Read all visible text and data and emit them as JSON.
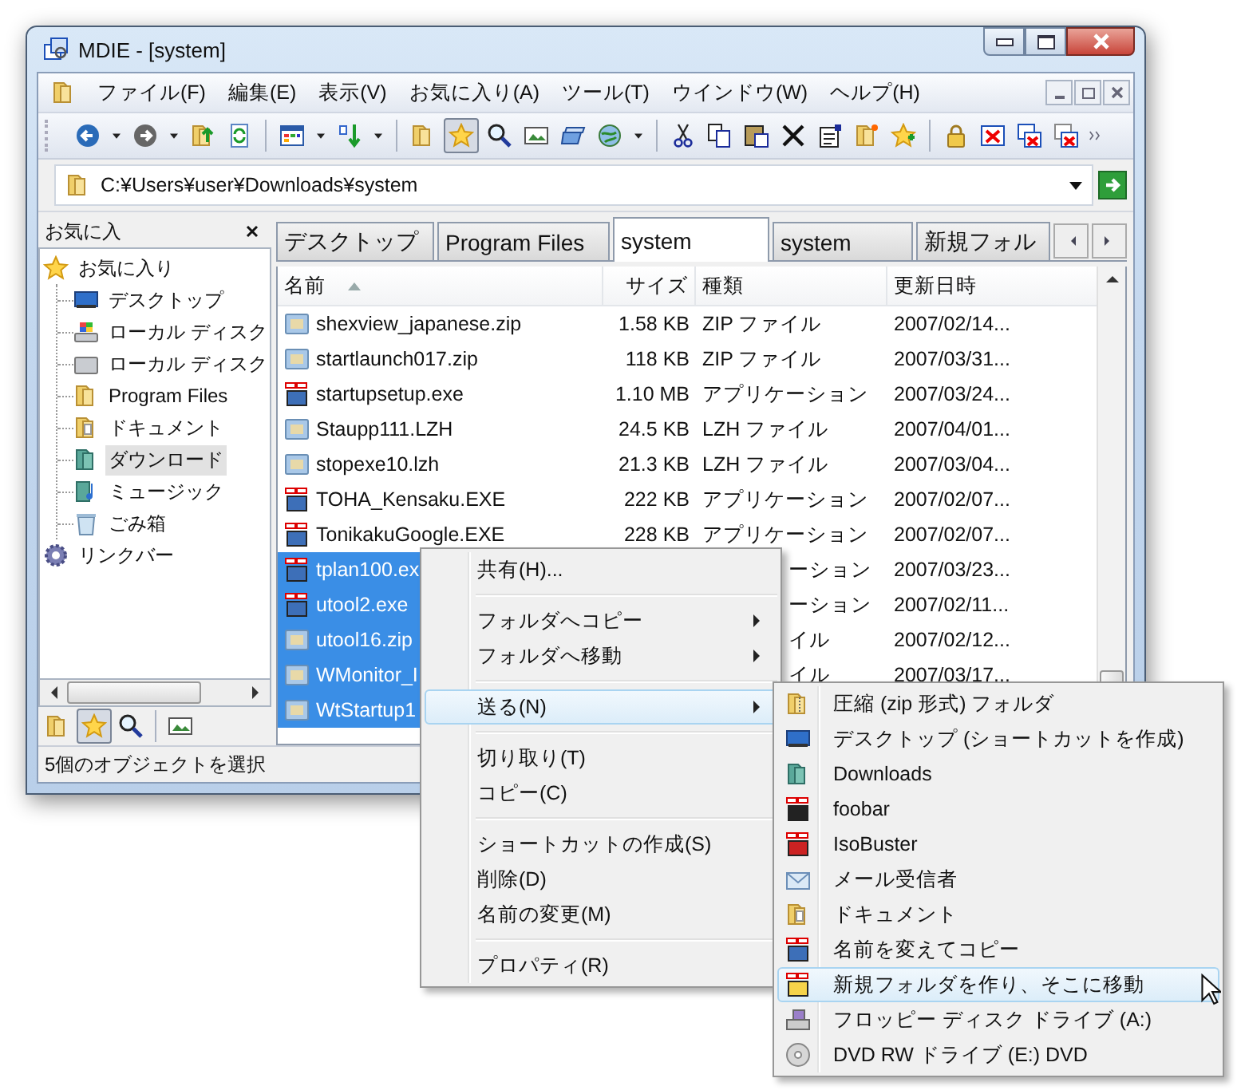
{
  "window": {
    "title": "MDIE - [system]"
  },
  "menubar": [
    "ファイル(F)",
    "編集(E)",
    "表示(V)",
    "お気に入り(A)",
    "ツール(T)",
    "ウインドウ(W)",
    "ヘルプ(H)"
  ],
  "toolbar": {
    "favorites_pressed": true
  },
  "address": {
    "value": "C:¥Users¥user¥Downloads¥system"
  },
  "sidebar": {
    "title": "お気に入",
    "favorites_pressed": true,
    "tree": [
      {
        "kind": "star",
        "label": "お気に入り",
        "selected": false,
        "children": [
          {
            "kind": "monitor",
            "label": "デスクトップ",
            "selected": false
          },
          {
            "kind": "windrive",
            "label": "ローカル ディスク",
            "selected": false
          },
          {
            "kind": "drive",
            "label": "ローカル ディスク",
            "selected": false
          },
          {
            "kind": "folder",
            "label": "Program Files",
            "selected": false
          },
          {
            "kind": "docs",
            "label": "ドキュメント",
            "selected": false
          },
          {
            "kind": "dl",
            "label": "ダウンロード",
            "selected": true
          },
          {
            "kind": "music",
            "label": "ミュージック",
            "selected": false
          },
          {
            "kind": "trash",
            "label": "ごみ箱",
            "selected": false
          }
        ]
      },
      {
        "kind": "gear",
        "label": "リンクバー",
        "selected": false
      }
    ]
  },
  "tabs": [
    {
      "label": "デスクトップ",
      "selected": false
    },
    {
      "label": "Program Files",
      "selected": false
    },
    {
      "label": "system",
      "selected": true
    },
    {
      "label": "system",
      "selected": false
    },
    {
      "label": "新規フォル",
      "selected": false
    }
  ],
  "columns": [
    {
      "label": "名前",
      "sorted": true
    },
    {
      "label": "サイズ",
      "sorted": false
    },
    {
      "label": "種類",
      "sorted": false
    },
    {
      "label": "更新日時",
      "sorted": false
    }
  ],
  "rows": [
    {
      "kind": "archive",
      "name": "shexview_japanese.zip",
      "size": "1.58 KB",
      "type": "ZIP ファイル",
      "modified": "2007/02/14...",
      "selected": false
    },
    {
      "kind": "archive",
      "name": "startlaunch017.zip",
      "size": "118 KB",
      "type": "ZIP ファイル",
      "modified": "2007/03/31...",
      "selected": false
    },
    {
      "kind": "exe",
      "name": "startupsetup.exe",
      "size": "1.10 MB",
      "type": "アプリケーション",
      "modified": "2007/03/24...",
      "selected": false
    },
    {
      "kind": "archive",
      "name": "Staupp111.LZH",
      "size": "24.5 KB",
      "type": "LZH ファイル",
      "modified": "2007/04/01...",
      "selected": false
    },
    {
      "kind": "archive",
      "name": "stopexe10.lzh",
      "size": "21.3 KB",
      "type": "LZH ファイル",
      "modified": "2007/03/04...",
      "selected": false
    },
    {
      "kind": "exe",
      "name": "TOHA_Kensaku.EXE",
      "size": "222 KB",
      "type": "アプリケーション",
      "modified": "2007/02/07...",
      "selected": false
    },
    {
      "kind": "exe",
      "name": "TonikakuGoogle.EXE",
      "size": "228 KB",
      "type": "アプリケーション",
      "modified": "2007/02/07...",
      "selected": false
    },
    {
      "kind": "exe",
      "name": "tplan100.ex",
      "type": "ーション",
      "modified": "2007/03/23...",
      "selected": true
    },
    {
      "kind": "exe",
      "name": "utool2.exe",
      "type": "ーション",
      "modified": "2007/02/11...",
      "selected": true
    },
    {
      "kind": "archive",
      "name": "utool16.zip",
      "type": "イル",
      "modified": "2007/02/12...",
      "selected": true
    },
    {
      "kind": "archive",
      "name": "WMonitor_I",
      "type": "イル",
      "modified": "2007/03/17...",
      "selected": true
    },
    {
      "kind": "archive",
      "name": "WtStartup1",
      "selected": true
    }
  ],
  "status_bar": "5個のオブジェクトを選択",
  "context_menu": [
    {
      "kind": "item",
      "label": "共有(H)...",
      "submenu": false,
      "selected": false
    },
    {
      "kind": "separator"
    },
    {
      "kind": "item",
      "label": "フォルダへコピー",
      "submenu": true,
      "selected": false
    },
    {
      "kind": "item",
      "label": "フォルダへ移動",
      "submenu": true,
      "selected": false
    },
    {
      "kind": "separator"
    },
    {
      "kind": "item",
      "label": "送る(N)",
      "submenu": true,
      "selected": true
    },
    {
      "kind": "separator"
    },
    {
      "kind": "item",
      "label": "切り取り(T)",
      "submenu": false,
      "selected": false
    },
    {
      "kind": "item",
      "label": "コピー(C)",
      "submenu": false,
      "selected": false
    },
    {
      "kind": "separator"
    },
    {
      "kind": "item",
      "label": "ショートカットの作成(S)",
      "submenu": false,
      "selected": false
    },
    {
      "kind": "item",
      "label": "削除(D)",
      "submenu": false,
      "selected": false
    },
    {
      "kind": "item",
      "label": "名前の変更(M)",
      "submenu": false,
      "selected": false
    },
    {
      "kind": "separator"
    },
    {
      "kind": "item",
      "label": "プロパティ(R)",
      "submenu": false,
      "selected": false
    }
  ],
  "send_to_menu": [
    {
      "kind": "zip",
      "label": "圧縮 (zip 形式) フォルダ",
      "selected": false
    },
    {
      "kind": "monitor",
      "label": "デスクトップ (ショートカットを作成)",
      "selected": false
    },
    {
      "kind": "dl",
      "label": "Downloads",
      "selected": false
    },
    {
      "kind": "media",
      "label": "foobar",
      "selected": false
    },
    {
      "kind": "iso",
      "label": "IsoBuster",
      "selected": false
    },
    {
      "kind": "mail",
      "label": "メール受信者",
      "selected": false
    },
    {
      "kind": "docs",
      "label": "ドキュメント",
      "selected": false
    },
    {
      "kind": "rename",
      "label": "名前を変えてコピー",
      "selected": false
    },
    {
      "kind": "newmove",
      "label": "新規フォルダを作り、そこに移動",
      "selected": true
    },
    {
      "kind": "floppy",
      "label": "フロッピー ディスク ドライブ (A:)",
      "selected": false
    },
    {
      "kind": "dvd",
      "label": "DVD RW ドライブ (E:) DVD",
      "selected": false
    }
  ]
}
